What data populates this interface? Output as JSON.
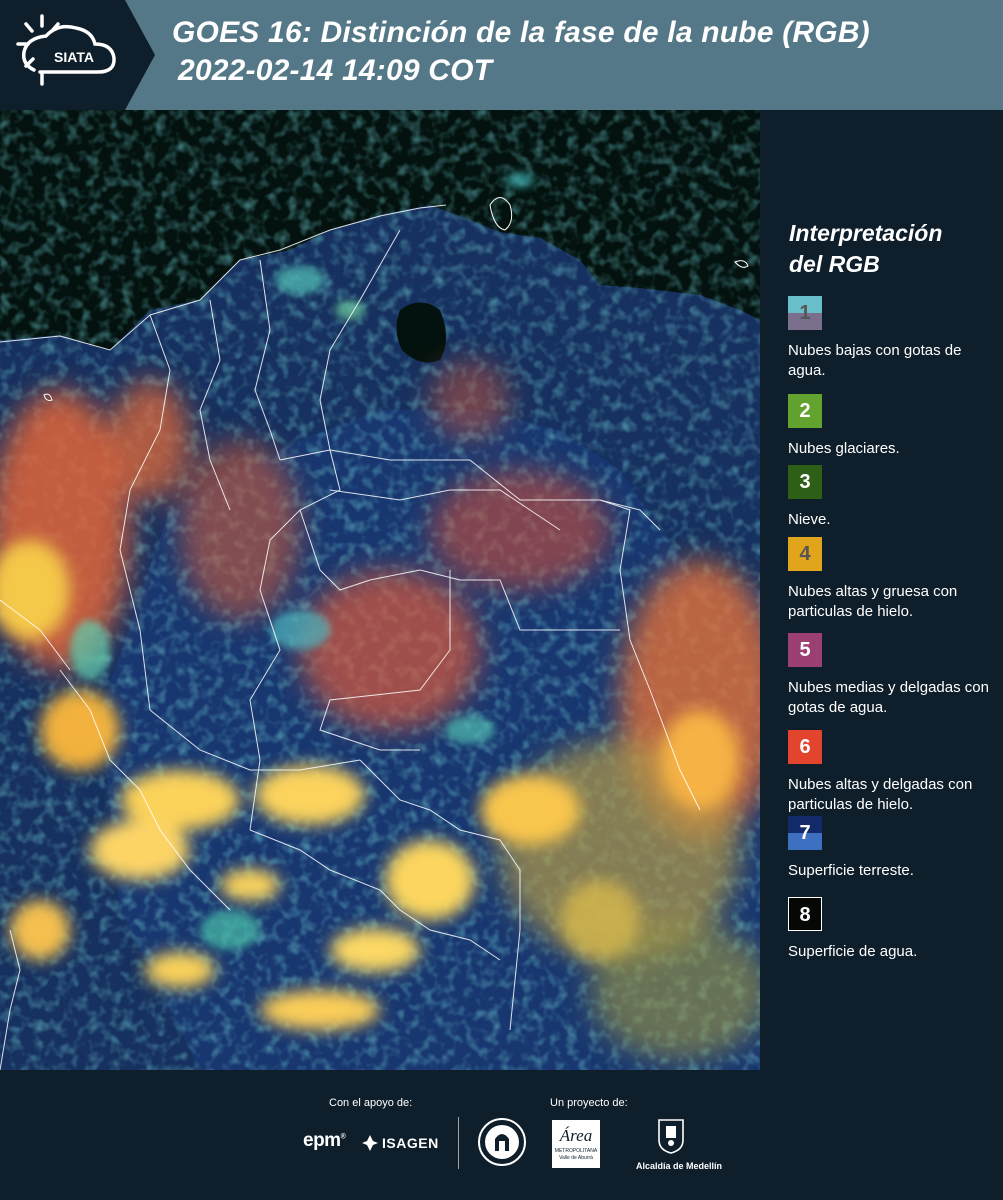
{
  "header": {
    "logo_text": "SIATA",
    "title_line1": "GOES 16: Distinción de la fase de la nube (RGB)",
    "title_line2": "2022-02-14 14:09 COT"
  },
  "legend": {
    "title_line1": "Interpretación",
    "title_line2": "del RGB",
    "items": [
      {
        "num": "1",
        "desc": "Nubes bajas con gotas de agua.",
        "color_top": "#69bfc9",
        "color_bottom": "#7a6f8c",
        "num_color": "#555555"
      },
      {
        "num": "2",
        "desc": "Nubes glaciares.",
        "color_top": "#62a22f",
        "color_bottom": "#62a22f",
        "num_color": "#ffffff"
      },
      {
        "num": "3",
        "desc": "Nieve.",
        "color_top": "#2e5f17",
        "color_bottom": "#2e5f17",
        "num_color": "#ffffff"
      },
      {
        "num": "4",
        "desc": "Nubes altas y gruesa con particulas de hielo.",
        "color_top": "#e0a51b",
        "color_bottom": "#e0a51b",
        "num_color": "#555555"
      },
      {
        "num": "5",
        "desc": "Nubes medias y delgadas con gotas de agua.",
        "color_top": "#9c3f73",
        "color_bottom": "#9c3f73",
        "num_color": "#ffffff"
      },
      {
        "num": "6",
        "desc": "Nubes altas y delgadas con particulas de hielo.",
        "color_top": "#e2442d",
        "color_bottom": "#e2442d",
        "num_color": "#ffffff"
      },
      {
        "num": "7",
        "desc": "Superficie terreste.",
        "color_top": "#132a6a",
        "color_bottom": "#3e6fc0",
        "num_color": "#ffffff"
      },
      {
        "num": "8",
        "desc": "Superficie de agua.",
        "color_top": "#050805",
        "color_bottom": "#050805",
        "num_color": "#ffffff"
      }
    ]
  },
  "footer": {
    "support_label": "Con el apoyo de:",
    "support_logos": [
      "epm",
      "ISAGEN"
    ],
    "project_label": "Un proyecto de:",
    "project_logos": [
      "Área Metropolitana Valle de Aburrá",
      "Alcaldía de Medellín"
    ],
    "alcaldia_text": "Alcaldía de Medellín",
    "area_text": "Área",
    "area_sub": "METROPOLITANA",
    "area_sub2": "Valle de Aburrá"
  }
}
